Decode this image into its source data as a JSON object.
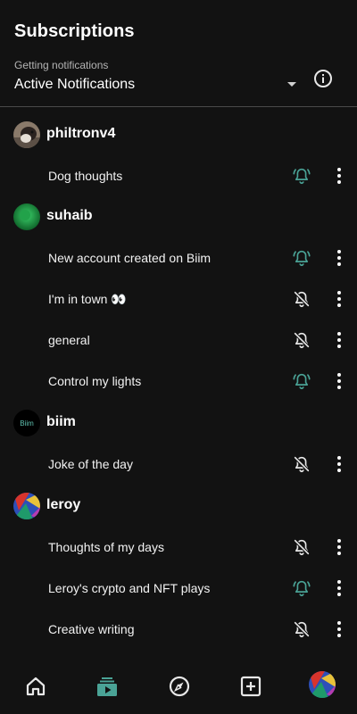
{
  "header": {
    "title": "Subscriptions",
    "filter_label": "Getting notifications",
    "filter_value": "Active Notifications",
    "info_icon": "info-icon"
  },
  "colors": {
    "background": "#121212",
    "accent": "#4aa396",
    "muted_icon": "#e8e8e8",
    "divider": "#4a4a4a"
  },
  "groups": [
    {
      "owner": "philtronv4",
      "channels": [
        {
          "name": "Dog thoughts",
          "notifications": "on"
        }
      ]
    },
    {
      "owner": "suhaib",
      "channels": [
        {
          "name": "New account created on Biim",
          "notifications": "on"
        },
        {
          "name": "I'm in town 👀",
          "notifications": "off"
        },
        {
          "name": "general",
          "notifications": "off"
        },
        {
          "name": "Control my lights",
          "notifications": "on"
        }
      ]
    },
    {
      "owner": "biim",
      "avatar_text": "Biim",
      "channels": [
        {
          "name": "Joke of the day",
          "notifications": "off"
        }
      ]
    },
    {
      "owner": "leroy",
      "channels": [
        {
          "name": "Thoughts of my days",
          "notifications": "off"
        },
        {
          "name": "Leroy's crypto and NFT plays",
          "notifications": "on"
        },
        {
          "name": "Creative writing",
          "notifications": "off"
        }
      ]
    }
  ],
  "bottom_nav": {
    "items": [
      "home-icon",
      "subscriptions-icon",
      "explore-icon",
      "add-icon",
      "profile-avatar"
    ],
    "active": "subscriptions-icon"
  }
}
